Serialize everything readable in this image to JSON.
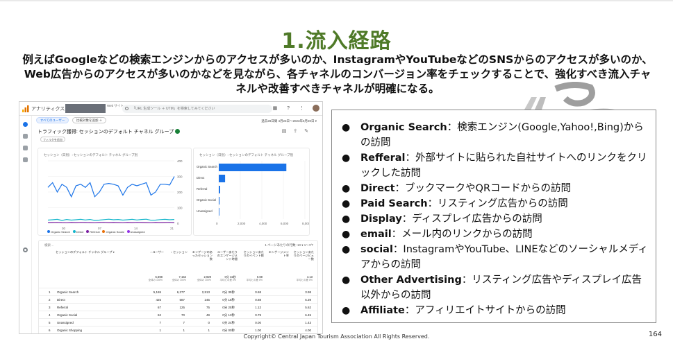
{
  "slide": {
    "title": "1.流入経路",
    "lead": "例えばGoogleなどの検索エンジンからのアクセスが多いのか、InstagramやYouTubeなどのSNSからのアクセスが多いのか、Web広告からのアクセスが多いのかなどを見ながら、各チャネルのコンバージョン率をチェックすることで、強化すべき流入チャネルや改善すべきチャネルが明確になる。",
    "copyright": "Copyright© Central Japan Tourism Association All Rights Reserved.",
    "page_number": "164",
    "accent_color": "#4f7a28"
  },
  "screenshot": {
    "app_name": "アナリティクス",
    "property_small": "Web\nサイト",
    "search_placeholder": "「URL 生成ツール ＋ UTM」を検索してみてください",
    "chip_all_users": "すべてのユーザー",
    "chip_compare": "比較対象を追加 ＋",
    "date_range": "過去28日間 4月23日〜2023年5月20日 ▾",
    "report_title": "トラフィック獲得: セッションのデフォルト チャネル グループ",
    "add_compare": "フィルタを追加",
    "line_card_title": "セッション（日別）: セッションのデフォルト チャネル グループ別",
    "bar_card_title": "セッション（日別）: セッションのデフォルト チャネル グループ別",
    "line_x_ticks": [
      "30",
      "07",
      "14",
      "21"
    ],
    "line_y_ticks": [
      "400",
      "300",
      "200",
      "100",
      "0"
    ],
    "bar_x_ticks": [
      "0",
      "2,000",
      "4,000",
      "6,000",
      "8,000"
    ],
    "legend": [
      "Organic Search",
      "Direct",
      "Referral",
      "Organic Social",
      "Unassigned"
    ],
    "legend_colors": [
      "#1a73e8",
      "#12b5cb",
      "#7b1fa2",
      "#e8710a",
      "#9334e6"
    ],
    "table_search": "検索…",
    "table_pager": "1 ページあたりの行数: 10 ▾    1〜7/7",
    "col_channel": "セッションのデフォルト チャネル グループ ▾",
    "col_headers": [
      "↓ ユーザー",
      "↓ セッション",
      "エンゲージのあったセッション数",
      "ユーザーあたりのエンゲージメント時間",
      "セッションあたりのイベント数",
      "エンゲージメント率",
      "セッションあたりのページビュー数"
    ],
    "totals": [
      "5,698",
      "7,152",
      "2,929",
      "0分 32秒",
      "0.69",
      "4.13"
    ],
    "totals_sub": [
      "全体の 100%",
      "全体の 100%",
      "全体の 100%",
      "平均との差 0%",
      "平均との差 0%",
      "平均との差 0%"
    ],
    "rows": [
      {
        "n": "1",
        "ch": "Organic Search",
        "v": [
          "5,165",
          "6,277",
          "2,513",
          "0分 35秒",
          "0.68",
          "3.98"
        ]
      },
      {
        "n": "2",
        "ch": "Direct",
        "v": [
          "425",
          "587",
          "245",
          "0分 18秒",
          "0.88",
          "5.39"
        ]
      },
      {
        "n": "3",
        "ch": "Referral",
        "v": [
          "67",
          "125",
          "75",
          "0分 25秒",
          "1.12",
          "5.62"
        ]
      },
      {
        "n": "4",
        "ch": "Organic Social",
        "v": [
          "62",
          "70",
          "49",
          "0分 13秒",
          "0.79",
          "6.45"
        ]
      },
      {
        "n": "5",
        "ch": "Unassigned",
        "v": [
          "7",
          "7",
          "0",
          "0分 24秒",
          "0.00",
          "1.43"
        ]
      },
      {
        "n": "6",
        "ch": "Organic Shopping",
        "v": [
          "1",
          "1",
          "1",
          "0分 00秒",
          "1.00",
          "4.00"
        ]
      }
    ],
    "chart_data": [
      {
        "type": "line",
        "x_ticks": [
          "30",
          "07",
          "14",
          "21"
        ],
        "ylim": [
          0,
          400
        ],
        "series": [
          {
            "name": "Organic Search",
            "values": [
              230,
              260,
              200,
              250,
              230,
              170,
              240,
              250,
              230,
              260,
              170,
              200,
              250,
              255,
              250,
              240,
              180,
              230,
              250,
              240,
              250,
              260,
              180,
              200,
              250,
              250,
              245,
              300
            ]
          },
          {
            "name": "Direct",
            "values": [
              20,
              22,
              25,
              18,
              24,
              20,
              22,
              25,
              21,
              24,
              18,
              20,
              23,
              26,
              22,
              24,
              20,
              22,
              25,
              21,
              24,
              26,
              19,
              20,
              23,
              25,
              22,
              24
            ]
          },
          {
            "name": "Referral",
            "values": [
              4,
              5,
              6,
              4,
              3,
              5,
              4,
              6,
              5,
              4,
              3,
              5,
              6,
              4,
              5,
              4,
              3,
              5,
              4,
              6,
              5,
              4,
              3,
              5,
              4,
              5,
              6,
              4
            ]
          }
        ]
      },
      {
        "type": "bar",
        "categories": [
          "Organic Search",
          "Direct",
          "Referral",
          "Organic Social",
          "Unassigned"
        ],
        "values": [
          6277,
          587,
          125,
          70,
          7
        ],
        "xlim": [
          0,
          8000
        ]
      }
    ]
  },
  "bullets": [
    {
      "term": "Organic Search",
      "desc": "：検索エンジン(Google,Yahoo!,Bing)からの訪問"
    },
    {
      "term": "Refferal",
      "desc": "：外部サイトに貼られた自社サイトへのリンクをクリックした訪問"
    },
    {
      "term": "Direct",
      "desc": "：ブックマークやQRコードからの訪問"
    },
    {
      "term": "Paid Search",
      "desc": "：リスティング広告からの訪問"
    },
    {
      "term": "Display",
      "desc": "：ディスプレイ広告からの訪問"
    },
    {
      "term": "email",
      "desc": "：メール内のリンクからの訪問"
    },
    {
      "term": "social",
      "desc": "：InstagramやYouTube、LINEなどのソーシャルメディアからの訪問"
    },
    {
      "term": "Other Advertising",
      "desc": "：リスティング広告やディスプレイ広告以外からの訪問"
    },
    {
      "term": "Affiliate",
      "desc": "：アフィリエイトサイトからの訪問"
    }
  ]
}
